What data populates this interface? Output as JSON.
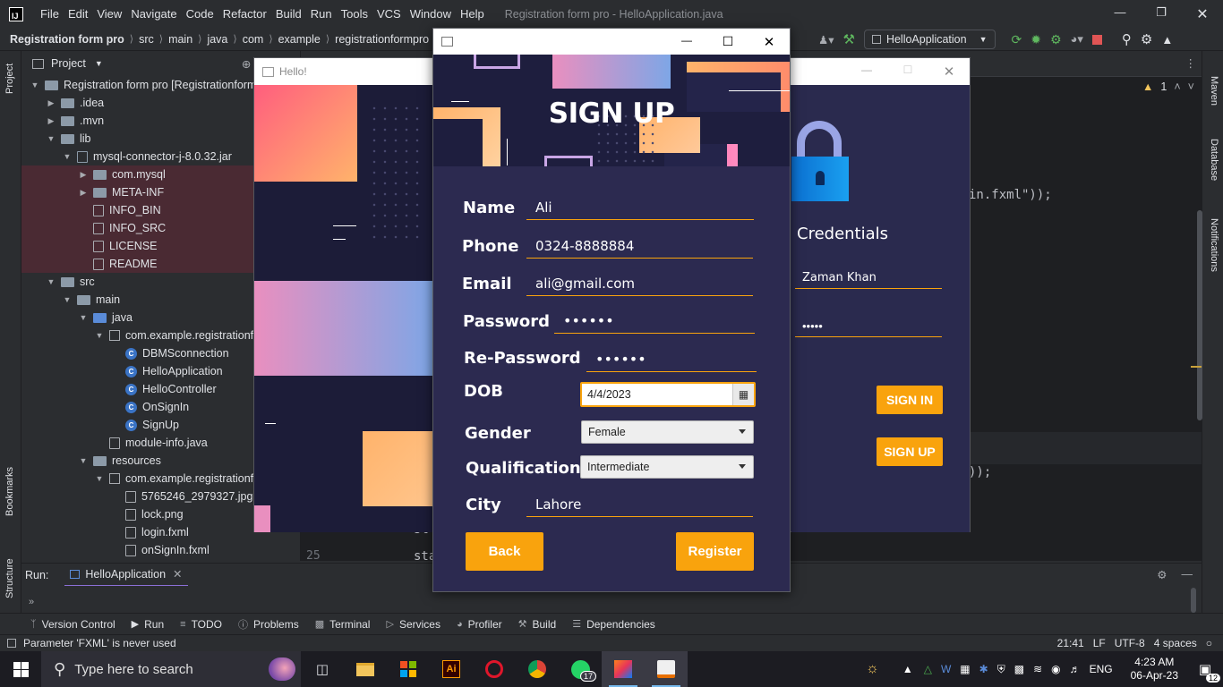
{
  "ide": {
    "menu": [
      "File",
      "Edit",
      "View",
      "Navigate",
      "Code",
      "Refactor",
      "Build",
      "Run",
      "Tools",
      "VCS",
      "Window",
      "Help"
    ],
    "window_title": "Registration form pro - HelloApplication.java",
    "breadcrumbs": [
      "Registration form pro",
      "src",
      "main",
      "java",
      "com",
      "example",
      "registrationformpro"
    ],
    "run_config": "HelloApplication",
    "left_tools": [
      "Project",
      "Bookmarks",
      "Structure"
    ],
    "right_tools": [
      "Maven",
      "Database",
      "Notifications"
    ],
    "project_panel_title": "Project",
    "tree": [
      {
        "label": "Registration form pro [Registrationform",
        "icon": "folder",
        "depth": 0,
        "arrow": "down",
        "bold": true
      },
      {
        "label": ".idea",
        "icon": "folder",
        "depth": 1,
        "arrow": "right"
      },
      {
        "label": ".mvn",
        "icon": "folder",
        "depth": 1,
        "arrow": "right"
      },
      {
        "label": "lib",
        "icon": "folder",
        "depth": 1,
        "arrow": "down"
      },
      {
        "label": "mysql-connector-j-8.0.32.jar",
        "icon": "jar",
        "depth": 2,
        "arrow": "down"
      },
      {
        "label": "com.mysql",
        "icon": "folder",
        "depth": 3,
        "arrow": "right",
        "hl": true
      },
      {
        "label": "META-INF",
        "icon": "folder",
        "depth": 3,
        "arrow": "right",
        "hl": true
      },
      {
        "label": "INFO_BIN",
        "icon": "file",
        "depth": 3,
        "hl": true
      },
      {
        "label": "INFO_SRC",
        "icon": "file",
        "depth": 3,
        "hl": true
      },
      {
        "label": "LICENSE",
        "icon": "file",
        "depth": 3,
        "hl": true
      },
      {
        "label": "README",
        "icon": "file",
        "depth": 3,
        "hl": true
      },
      {
        "label": "src",
        "icon": "folder",
        "depth": 1,
        "arrow": "down"
      },
      {
        "label": "main",
        "icon": "folder",
        "depth": 2,
        "arrow": "down"
      },
      {
        "label": "java",
        "icon": "srcfolder",
        "depth": 3,
        "arrow": "down"
      },
      {
        "label": "com.example.registrationfo",
        "icon": "package",
        "depth": 4,
        "arrow": "down"
      },
      {
        "label": "DBMSconnection",
        "icon": "class",
        "depth": 5
      },
      {
        "label": "HelloApplication",
        "icon": "class",
        "depth": 5
      },
      {
        "label": "HelloController",
        "icon": "class",
        "depth": 5
      },
      {
        "label": "OnSignIn",
        "icon": "class",
        "depth": 5
      },
      {
        "label": "SignUp",
        "icon": "class",
        "depth": 5
      },
      {
        "label": "module-info.java",
        "icon": "file",
        "depth": 4
      },
      {
        "label": "resources",
        "icon": "folder",
        "depth": 3,
        "arrow": "down"
      },
      {
        "label": "com.example.registrationfo",
        "icon": "package",
        "depth": 4,
        "arrow": "down"
      },
      {
        "label": "5765246_2979327.jpg",
        "icon": "file",
        "depth": 5
      },
      {
        "label": "lock.png",
        "icon": "file",
        "depth": 5
      },
      {
        "label": "login.fxml",
        "icon": "file",
        "depth": 5
      },
      {
        "label": "onSignIn.fxml",
        "icon": "file",
        "depth": 5
      }
    ],
    "editor": {
      "warning_count": "1",
      "snippet_1": "in.fxml\"));",
      "snippet_2": "));",
      "line_number": "25",
      "code_fragment_1": "st",
      "code_fragment_2": "sta"
    },
    "run_label": "Run:",
    "run_tab": "HelloApplication",
    "bottom_tools": [
      "Version Control",
      "Run",
      "TODO",
      "Problems",
      "Terminal",
      "Services",
      "Profiler",
      "Build",
      "Dependencies"
    ],
    "status_message": "Parameter 'FXML' is never used",
    "status_right": {
      "position": "21:41",
      "line_sep": "LF",
      "encoding": "UTF-8",
      "indent": "4 spaces"
    }
  },
  "taskbar": {
    "search_placeholder": "Type here to search",
    "whatsapp_badge": "17",
    "language": "ENG",
    "time": "4:23 AM",
    "date": "06-Apr-23",
    "notification_count": "12"
  },
  "hello_window": {
    "title": "Hello!",
    "heading": "Credentials",
    "username": "Zaman Khan",
    "password_mask": "•••••",
    "signin_label": "SIGN IN",
    "signup_label": "SIGN UP"
  },
  "signup_window": {
    "heading": "SIGN UP",
    "labels": {
      "name": "Name",
      "phone": "Phone",
      "email": "Email",
      "password": "Password",
      "repassword": "Re-Password",
      "dob": "DOB",
      "gender": "Gender",
      "qualification": "Qualification",
      "city": "City"
    },
    "values": {
      "name": "Ali",
      "phone": "0324-8888884",
      "email": "ali@gmail.com",
      "password": "••••••",
      "repassword": "••••••",
      "dob": "4/4/2023",
      "gender": "Female",
      "qualification": "Intermediate",
      "city": "Lahore"
    },
    "back_label": "Back",
    "register_label": "Register"
  },
  "colors": {
    "accent_orange": "#f9a30d",
    "form_bg": "#2c2a50",
    "ide_bg": "#2b2d30",
    "editor_bg": "#1e1f22"
  }
}
